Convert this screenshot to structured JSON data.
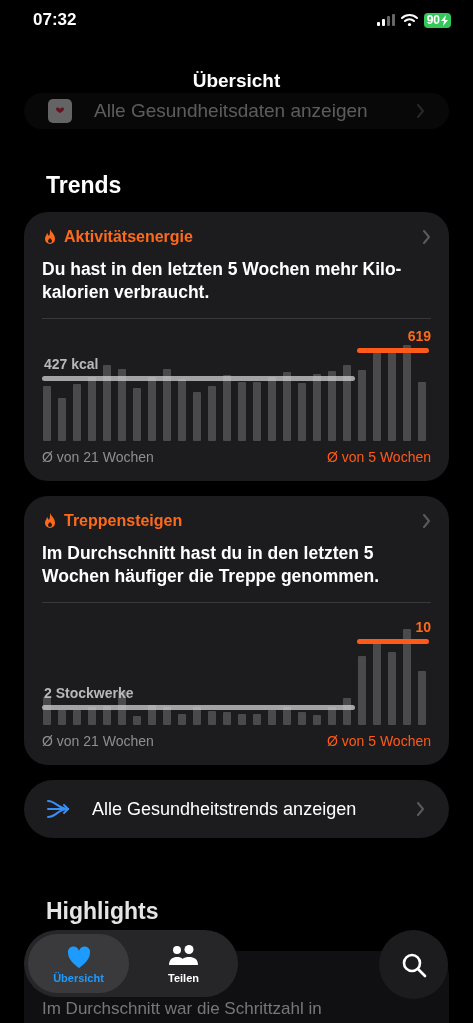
{
  "status_bar": {
    "time": "07:32",
    "battery": "90"
  },
  "nav_title": "Übersicht",
  "all_data_row": {
    "label": "Alle Gesundheitsdaten anzeigen"
  },
  "trends_heading": "Trends",
  "trend_cards": [
    {
      "category": "Aktivitätsenergie",
      "summary": "Du hast in den letzten 5 Wochen mehr Kilo-kalorien verbraucht.",
      "baseline_label": "427 kcal",
      "recent_label": "619",
      "baseline_caption": "Ø von 21 Wochen",
      "recent_caption": "Ø von 5 Wochen"
    },
    {
      "category": "Treppensteigen",
      "summary": "Im Durchschnitt hast du in den letzten 5 Wochen häufiger die Treppe genommen.",
      "baseline_label": "2 Stockwerke",
      "recent_label": "10",
      "baseline_caption": "Ø von 21 Wochen",
      "recent_caption": "Ø von 5 Wochen"
    }
  ],
  "all_trends_row": {
    "label": "Alle Gesundheitstrends anzeigen"
  },
  "highlights_heading": "Highlights",
  "highlight_text": "Im Durchschnitt war die Schrittzahl in",
  "tab_bar": {
    "tabs": [
      {
        "label": "Übersicht",
        "selected": true
      },
      {
        "label": "Teilen",
        "selected": false
      }
    ]
  }
}
